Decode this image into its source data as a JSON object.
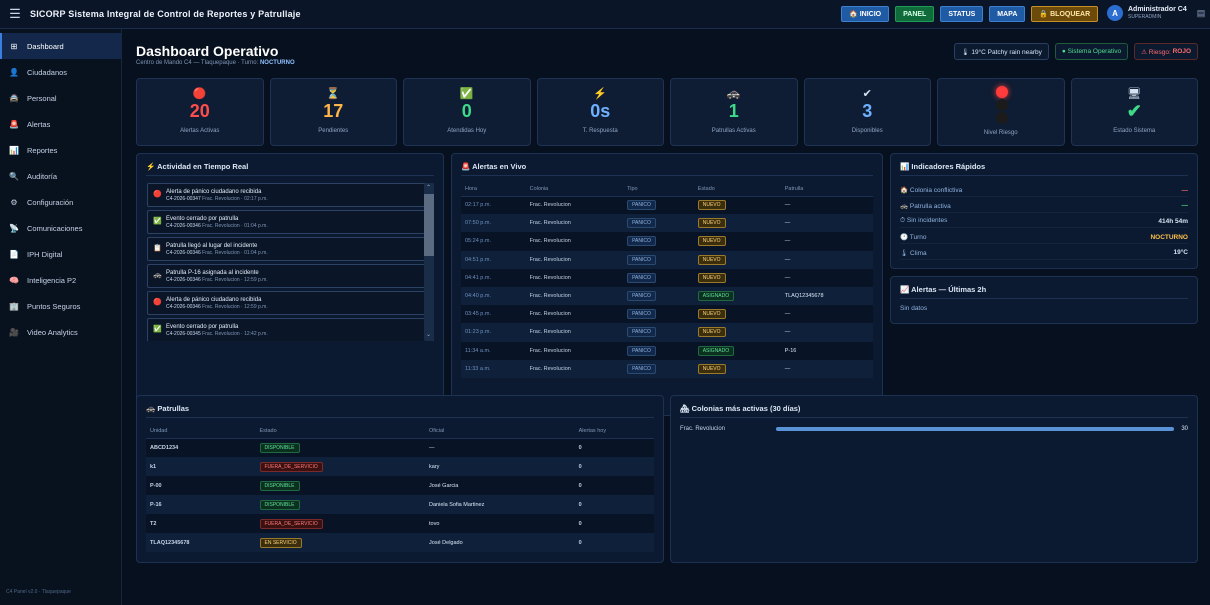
{
  "app": {
    "title": "SICORP Sistema Integral de Control de Reportes y Patrullaje"
  },
  "topnav": {
    "inicio": "INICIO",
    "panel": "PANEL",
    "status": "STATUS",
    "mapa": "MAPA",
    "bloquear": "BLOQUEAR"
  },
  "user": {
    "initial": "A",
    "name": "Administrador C4",
    "role": "SUPERADMIN"
  },
  "sidebar": {
    "items": [
      {
        "label": "Dashboard",
        "icon": "⊞"
      },
      {
        "label": "Ciudadanos",
        "icon": "👤"
      },
      {
        "label": "Personal",
        "icon": "🚔"
      },
      {
        "label": "Alertas",
        "icon": "🚨"
      },
      {
        "label": "Reportes",
        "icon": "📊"
      },
      {
        "label": "Auditoría",
        "icon": "🔍"
      },
      {
        "label": "Configuración",
        "icon": "⚙"
      },
      {
        "label": "Comunicaciones",
        "icon": "📡"
      },
      {
        "label": "IPH Digital",
        "icon": "📄"
      },
      {
        "label": "Inteligencia P2",
        "icon": "🧠"
      },
      {
        "label": "Puntos Seguros",
        "icon": "🏢"
      },
      {
        "label": "Video Analytics",
        "icon": "🎥"
      }
    ],
    "footer": "C4 Panel v2.0 · Tlaquepaque"
  },
  "page": {
    "title": "Dashboard Operativo",
    "subtitle": "Centro de Mando C4 — Tlaquepaque · Turno:",
    "turno": "NOCTURNO"
  },
  "badges": {
    "weather": "🌡 19°C Patchy rain nearby",
    "system": "● Sistema Operativo",
    "risk_label": "⚠ Riesgo:",
    "risk_value": "ROJO"
  },
  "kpis": [
    {
      "icon": "🔴",
      "value": "20",
      "label": "Alertas Activas",
      "color": "#ff4d4d"
    },
    {
      "icon": "⏳",
      "value": "17",
      "label": "Pendientes",
      "color": "#ffb547"
    },
    {
      "icon": "✅",
      "value": "0",
      "label": "Atendidas Hoy",
      "color": "#3fd98a"
    },
    {
      "icon": "⚡",
      "value": "0s",
      "label": "T. Respuesta",
      "color": "#6fb0ff"
    },
    {
      "icon": "🚓",
      "value": "1",
      "label": "Patrullas Activas",
      "color": "#3fd98a"
    },
    {
      "icon": "✔",
      "value": "3",
      "label": "Disponibles",
      "color": "#6fb0ff"
    },
    {
      "icon": "",
      "value": "",
      "label": "Nivel Riesgo",
      "color": "#ff3b3b"
    },
    {
      "icon": "🖥",
      "value": "✔",
      "label": "Estado Sistema",
      "color": "#3fd98a"
    }
  ],
  "actividad": {
    "title": "⚡ Actividad en Tiempo Real",
    "items": [
      {
        "icon": "🔴",
        "text": "Alerta de pánico ciudadano recibida",
        "code": "C4-2026-00347",
        "meta": "Frac. Revolucion · 02:17 p.m."
      },
      {
        "icon": "✅",
        "text": "Evento cerrado por patrulla",
        "code": "C4-2026-00346",
        "meta": "Frac. Revolucion · 01:04 p.m."
      },
      {
        "icon": "📋",
        "text": "Patrulla llegó al lugar del incidente",
        "code": "C4-2026-00346",
        "meta": "Frac. Revolucion · 01:04 p.m."
      },
      {
        "icon": "🚓",
        "text": "Patrulla P-16 asignada al incidente",
        "code": "C4-2026-00346",
        "meta": "Frac. Revolucion · 12:59 p.m."
      },
      {
        "icon": "🔴",
        "text": "Alerta de pánico ciudadano recibida",
        "code": "C4-2026-00346",
        "meta": "Frac. Revolucion · 12:59 p.m."
      },
      {
        "icon": "✅",
        "text": "Evento cerrado por patrulla",
        "code": "C4-2026-00345",
        "meta": "Frac. Revolucion · 12:42 p.m."
      }
    ]
  },
  "alertas": {
    "title": "🚨 Alertas en Vivo",
    "headers": [
      "Hora",
      "Colonia",
      "Tipo",
      "Estado",
      "Patrulla"
    ],
    "rows": [
      [
        "02:17 p.m.",
        "Frac. Revolucion",
        "PANICO",
        "NUEVO",
        "—"
      ],
      [
        "07:50 p.m.",
        "Frac. Revolucion",
        "PANICO",
        "NUEVO",
        "—"
      ],
      [
        "05:24 p.m.",
        "Frac. Revolucion",
        "PANICO",
        "NUEVO",
        "—"
      ],
      [
        "04:51 p.m.",
        "Frac. Revolucion",
        "PANICO",
        "NUEVO",
        "—"
      ],
      [
        "04:41 p.m.",
        "Frac. Revolucion",
        "PANICO",
        "NUEVO",
        "—"
      ],
      [
        "04:40 p.m.",
        "Frac. Revolucion",
        "PANICO",
        "ASIGNADO",
        "TLAQ12345678"
      ],
      [
        "03:45 p.m.",
        "Frac. Revolucion",
        "PANICO",
        "NUEVO",
        "—"
      ],
      [
        "01:23 p.m.",
        "Frac. Revolucion",
        "PANICO",
        "NUEVO",
        "—"
      ],
      [
        "11:34 a.m.",
        "Frac. Revolucion",
        "PANICO",
        "ASIGNADO",
        "P-16"
      ],
      [
        "11:33 a.m.",
        "Frac. Revolucion",
        "PANICO",
        "NUEVO",
        "—"
      ]
    ]
  },
  "indicadores": {
    "title": "📊 Indicadores Rápidos",
    "items": [
      {
        "label": "🏠 Colonia conflictiva",
        "value": "—",
        "color": "#ff6b6b"
      },
      {
        "label": "🚓 Patrulla activa",
        "value": "—",
        "color": "#4fdc8b"
      },
      {
        "label": "⏱ Sin incidentes",
        "value": "414h 54m",
        "color": "#d7e3f4"
      },
      {
        "label": "🕐 Turno",
        "value": "NOCTURNO",
        "color": "#ffc14a"
      },
      {
        "label": "🌡 Clima",
        "value": "19°C",
        "color": "#d7e3f4"
      }
    ]
  },
  "alertas2h": {
    "title": "📈 Alertas — Últimas 2h",
    "empty": "Sin datos"
  },
  "patrullas": {
    "title": "🚓 Patrullas",
    "headers": [
      "Unidad",
      "Estado",
      "Oficial",
      "Alertas hoy"
    ],
    "rows": [
      [
        "ABCD1234",
        "DISPONIBLE",
        "—",
        "0"
      ],
      [
        "k1",
        "FUERA_DE_SERVICIO",
        "kary",
        "0"
      ],
      [
        "P-00",
        "DISPONIBLE",
        "José Garcia",
        "0"
      ],
      [
        "P-16",
        "DISPONIBLE",
        "Daniela Sofia Martinez",
        "0"
      ],
      [
        "T2",
        "FUERA_DE_SERVICIO",
        "tovo",
        "0"
      ],
      [
        "TLAQ12345678",
        "EN SERVICIO",
        "José Delgado",
        "0"
      ]
    ]
  },
  "colonias": {
    "title": "🏘 Colonias más activas (30 días)",
    "items": [
      {
        "name": "Frac. Revolucion",
        "value": 30,
        "fraction": 1.0
      }
    ]
  }
}
